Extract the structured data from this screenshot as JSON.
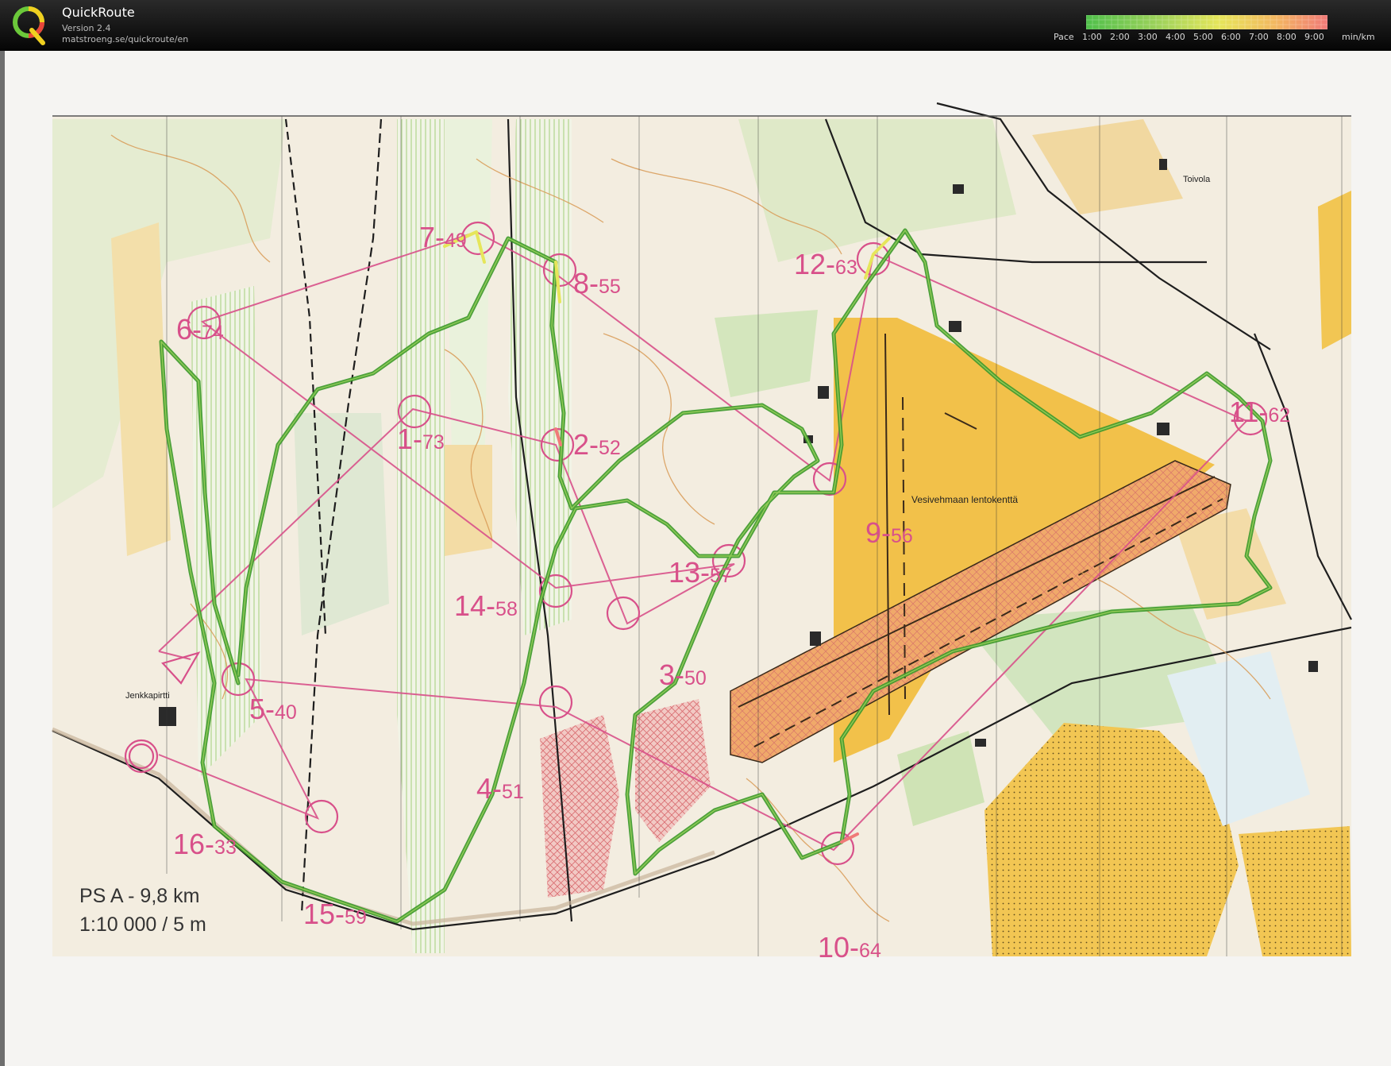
{
  "app": {
    "name": "QuickRoute",
    "version": "Version 2.4",
    "url": "matstroeng.se/quickroute/en"
  },
  "pace_scale": {
    "label": "Pace",
    "ticks": [
      "1:00",
      "2:00",
      "3:00",
      "4:00",
      "5:00",
      "6:00",
      "7:00",
      "8:00",
      "9:00"
    ],
    "unit": "min/km",
    "colors": [
      "#4fbf4a",
      "#9ed25a",
      "#e6e65a",
      "#f3b860",
      "#f07a78"
    ]
  },
  "map": {
    "course_info": "PS A  - 9,8 km",
    "scale_info": "1:10 000 / 5 m",
    "airfield_name": "Vesivehmaan lentokenttä",
    "place_toivola": "Toivola",
    "place_jenkkapirtti": "Jenkkapirtti",
    "controls": [
      {
        "number": "1",
        "code": "73"
      },
      {
        "number": "2",
        "code": "52"
      },
      {
        "number": "3",
        "code": "50"
      },
      {
        "number": "4",
        "code": "51"
      },
      {
        "number": "5",
        "code": "40"
      },
      {
        "number": "6",
        "code": "74"
      },
      {
        "number": "7",
        "code": "49"
      },
      {
        "number": "8",
        "code": "55"
      },
      {
        "number": "9",
        "code": "56"
      },
      {
        "number": "10",
        "code": "64"
      },
      {
        "number": "11",
        "code": "62"
      },
      {
        "number": "12",
        "code": "63"
      },
      {
        "number": "13",
        "code": "57"
      },
      {
        "number": "14",
        "code": "58"
      },
      {
        "number": "15",
        "code": "59"
      },
      {
        "number": "16",
        "code": "33"
      }
    ]
  },
  "colors": {
    "map_background": "#f3ede0",
    "open_land_yellow": "#f3c24a",
    "forest_green": "#d7e9c4",
    "course_magenta": "#d8508a",
    "route_green": "#3f9a2e",
    "contour_brown": "#d89a55"
  }
}
